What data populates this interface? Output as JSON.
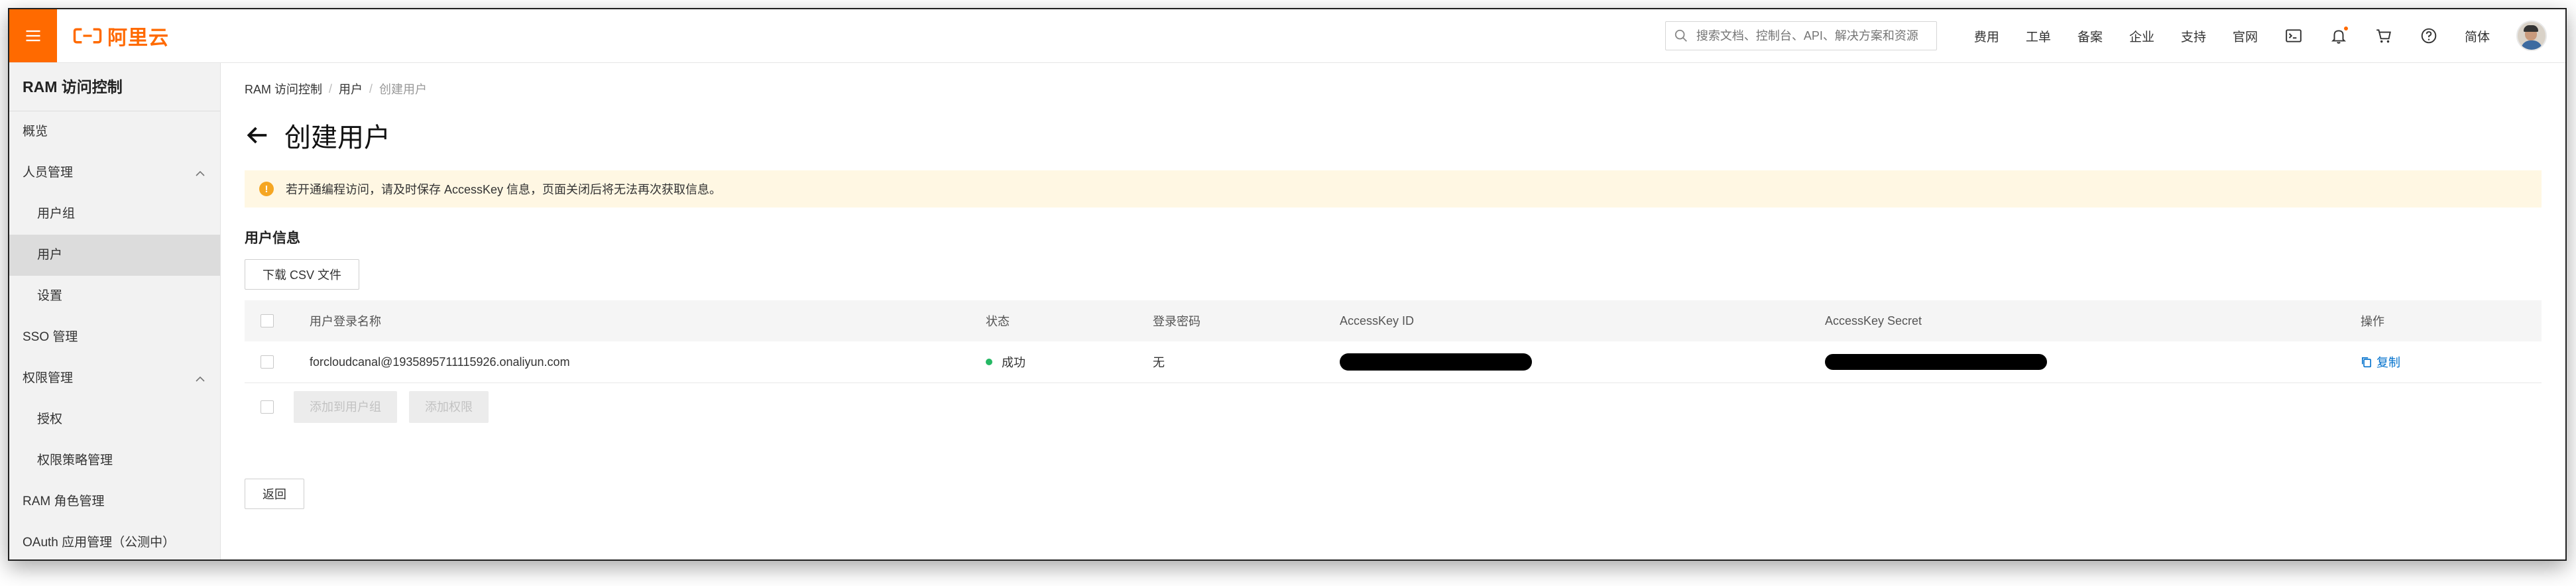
{
  "topbar": {
    "brand": "阿里云",
    "search_placeholder": "搜索文档、控制台、API、解决方案和资源",
    "links": [
      "费用",
      "工单",
      "备案",
      "企业",
      "支持",
      "官网"
    ],
    "lang": "简体"
  },
  "sidebar": {
    "title": "RAM 访问控制",
    "items": [
      {
        "label": "概览"
      },
      {
        "label": "人员管理"
      },
      {
        "label": "用户组"
      },
      {
        "label": "用户"
      },
      {
        "label": "设置"
      },
      {
        "label": "SSO 管理"
      },
      {
        "label": "权限管理"
      },
      {
        "label": "授权"
      },
      {
        "label": "权限策略管理"
      },
      {
        "label": "RAM 角色管理"
      },
      {
        "label": "OAuth 应用管理（公测中）"
      }
    ]
  },
  "breadcrumb": [
    "RAM 访问控制",
    "用户",
    "创建用户"
  ],
  "page_title": "创建用户",
  "alert_text": "若开通编程访问，请及时保存 AccessKey 信息，页面关闭后将无法再次获取信息。",
  "section_title": "用户信息",
  "download_csv": "下载 CSV 文件",
  "table": {
    "headers": [
      "用户登录名称",
      "状态",
      "登录密码",
      "AccessKey ID",
      "AccessKey Secret",
      "操作"
    ],
    "rows": [
      {
        "login_name": "forcloudcanal@1935895711115926.onaliyun.com",
        "status": "成功",
        "password": "无",
        "op": "复制"
      }
    ],
    "footer_buttons": [
      "添加到用户组",
      "添加权限"
    ]
  },
  "back_button": "返回",
  "colors": {
    "brand": "#ff6a00",
    "success": "#25b864",
    "link": "#0070cc",
    "alert_bg": "#fff7e3"
  }
}
